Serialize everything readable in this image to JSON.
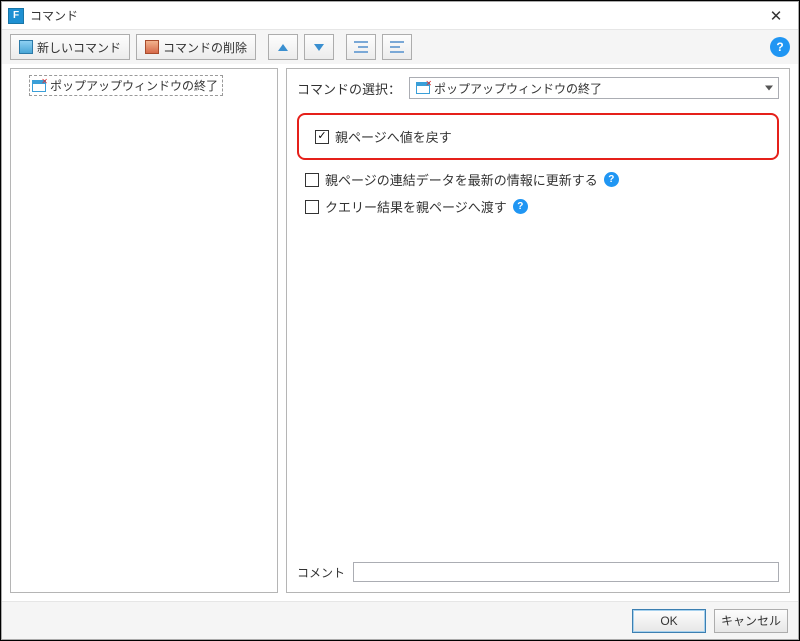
{
  "window": {
    "title": "コマンド"
  },
  "toolbar": {
    "new_command": "新しいコマンド",
    "delete_command": "コマンドの削除"
  },
  "tree": {
    "items": [
      {
        "label": "ポップアップウィンドウの終了"
      }
    ]
  },
  "right": {
    "select_label": "コマンドの選択：",
    "selected_command": "ポップアップウィンドウの終了",
    "options": {
      "return_value": {
        "label": "親ページへ値を戻す",
        "checked": true
      },
      "refresh_parent": {
        "label": "親ページの連結データを最新の情報に更新する",
        "checked": false
      },
      "pass_query": {
        "label": "クエリー結果を親ページへ渡す",
        "checked": false
      }
    },
    "comment_label": "コメント",
    "comment_value": ""
  },
  "footer": {
    "ok": "OK",
    "cancel": "キャンセル"
  }
}
